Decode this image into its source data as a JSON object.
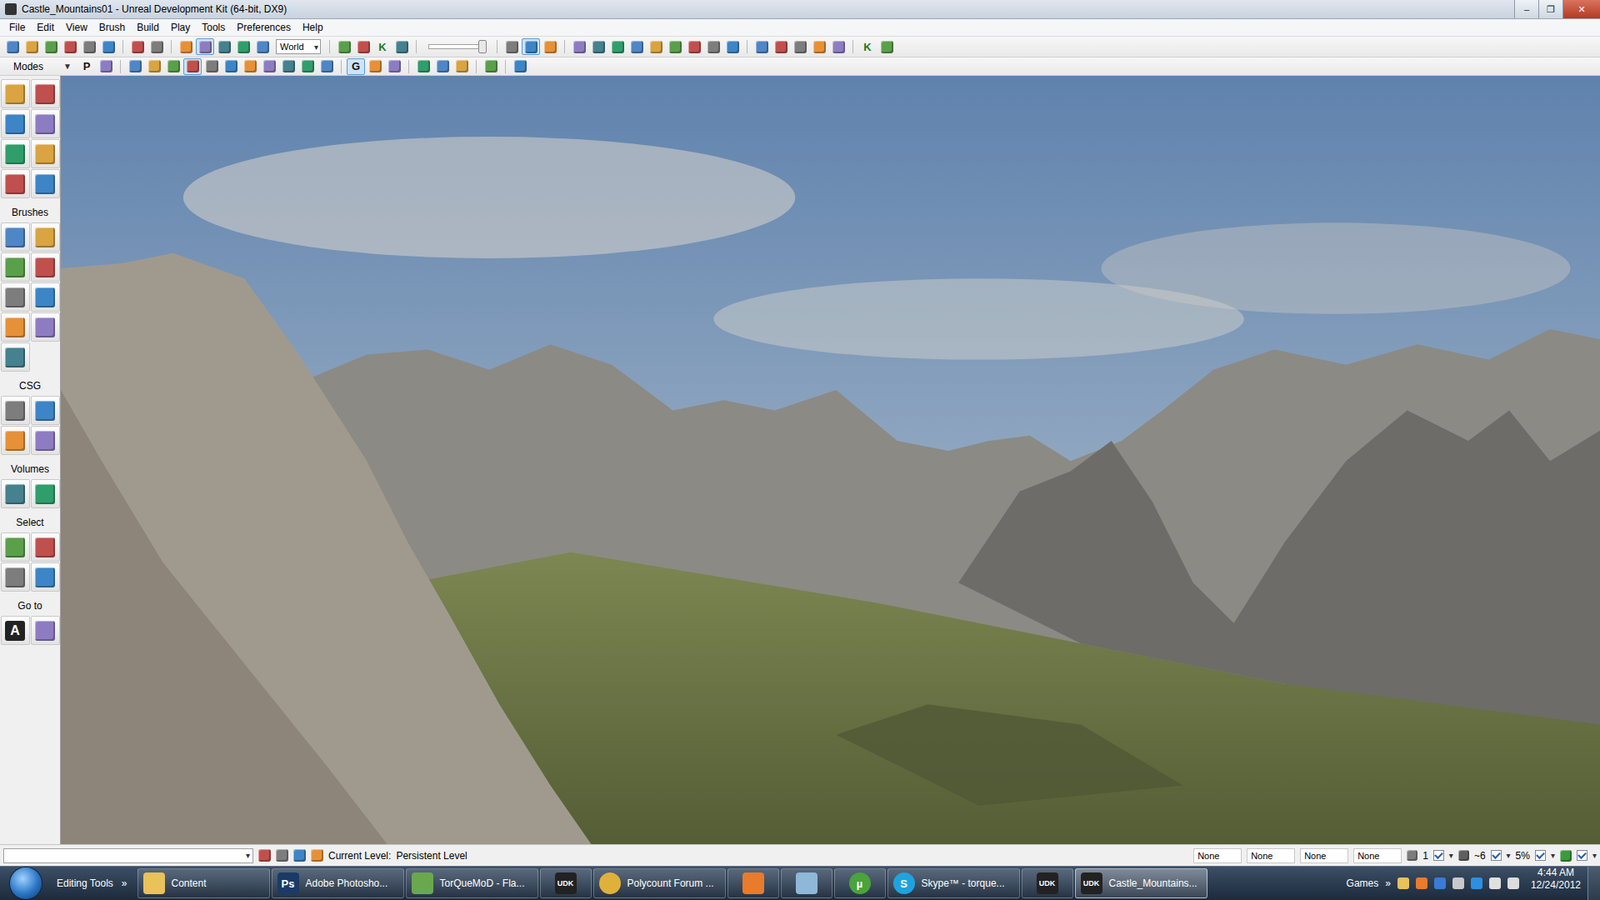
{
  "window": {
    "title": "Castle_Mountains01 - Unreal Development Kit (64-bit, DX9)",
    "controls": [
      "–",
      "❐",
      "✕"
    ]
  },
  "menu": [
    "File",
    "Edit",
    "View",
    "Brush",
    "Build",
    "Play",
    "Tools",
    "Preferences",
    "Help"
  ],
  "toolbar": [
    {
      "kind": "icons",
      "sep": false,
      "selected": [
        false,
        false,
        false,
        false,
        false,
        false
      ]
    },
    {
      "kind": "icons",
      "sep": true,
      "selected": [
        false,
        false
      ]
    },
    {
      "kind": "icons",
      "sep": true,
      "selected": [
        false,
        true,
        false,
        false,
        false
      ]
    },
    {
      "kind": "dropdown",
      "sep": false,
      "value": "World",
      "arrow": "▾"
    },
    {
      "kind": "icons",
      "sep": true,
      "selected": [
        false,
        false
      ]
    },
    {
      "kind": "letter",
      "sep": false,
      "text": "K",
      "selected": false
    },
    {
      "kind": "icons",
      "sep": false,
      "selected": [
        false
      ]
    },
    {
      "kind": "slider",
      "sep": true,
      "level": 0.95
    },
    {
      "kind": "icons",
      "sep": true,
      "selected": [
        false,
        true,
        false
      ]
    },
    {
      "kind": "icons",
      "sep": true,
      "selected": [
        false,
        false,
        false,
        false,
        false,
        false,
        false,
        false,
        false
      ]
    },
    {
      "kind": "icons",
      "sep": true,
      "selected": [
        false
      ]
    },
    {
      "kind": "icons",
      "sep": false,
      "selected": [
        false,
        false
      ]
    },
    {
      "kind": "icons",
      "sep": false,
      "selected": [
        false,
        false
      ]
    },
    {
      "kind": "letter",
      "sep": true,
      "text": "K",
      "selected": false
    },
    {
      "kind": "icons",
      "sep": false,
      "selected": [
        false
      ]
    }
  ],
  "mode_bar": {
    "label": "Modes",
    "menu_glyph": "▼",
    "items": [
      {
        "kind": "letter",
        "sep": false,
        "text": "P",
        "selected": false
      },
      {
        "kind": "icons",
        "sep": false,
        "selected": [
          false
        ]
      },
      {
        "kind": "icons",
        "sep": true,
        "selected": [
          false,
          false,
          false,
          true,
          false,
          false,
          false,
          false,
          false,
          false,
          false
        ]
      },
      {
        "kind": "letter",
        "sep": true,
        "text": "G",
        "selected": true
      },
      {
        "kind": "icons",
        "sep": false,
        "selected": [
          false,
          false
        ]
      },
      {
        "kind": "icons",
        "sep": true,
        "selected": [
          false,
          false,
          false
        ]
      },
      {
        "kind": "icons",
        "sep": true,
        "selected": [
          false
        ]
      },
      {
        "kind": "icons",
        "sep": true,
        "selected": [
          false
        ]
      }
    ]
  },
  "sidebar": {
    "mode_buttons": [
      {
        "selected": false
      },
      {
        "selected": false
      },
      {
        "selected": false
      },
      {
        "selected": false
      },
      {
        "selected": false
      },
      {
        "selected": false
      },
      {
        "selected": false
      },
      {
        "selected": false
      }
    ],
    "sections": [
      {
        "label": "Brushes",
        "buttons": [
          {
            "text": ""
          },
          {
            "text": ""
          },
          {
            "text": ""
          },
          {
            "text": ""
          },
          {
            "text": ""
          },
          {
            "text": ""
          },
          {
            "text": ""
          },
          {
            "text": ""
          },
          {
            "text": ""
          }
        ]
      },
      {
        "label": "CSG",
        "buttons": [
          {
            "text": ""
          },
          {
            "text": ""
          },
          {
            "text": ""
          },
          {
            "text": ""
          }
        ]
      },
      {
        "label": "Volumes",
        "buttons": [
          {
            "text": ""
          },
          {
            "text": ""
          }
        ]
      },
      {
        "label": "Select",
        "buttons": [
          {
            "text": ""
          },
          {
            "text": ""
          },
          {
            "text": ""
          },
          {
            "text": ""
          }
        ]
      },
      {
        "label": "Go to",
        "buttons": [
          {
            "text": "A"
          },
          {
            "text": ""
          }
        ]
      }
    ]
  },
  "status_bar": {
    "level_arrow": "▾",
    "current_level_label": "Current Level:",
    "current_level": "Persistent Level",
    "fields": [
      "None",
      "None",
      "None",
      "None"
    ],
    "grid_size": "1",
    "rotation": "~6",
    "scale": "5%",
    "arrow": "▾",
    "toggles": [
      {
        "checked": true
      },
      {
        "checked": true
      },
      {
        "checked": true
      },
      {
        "checked": true
      }
    ]
  },
  "taskbar": {
    "toolbar_label": "Editing Tools",
    "more": "»",
    "items": [
      {
        "kind": "folder",
        "label": "Content",
        "glyph": "",
        "selected": false
      },
      {
        "kind": "photoshop",
        "label": "Adobe Photosho...",
        "glyph": "Ps",
        "selected": false
      },
      {
        "kind": "flash",
        "label": "TorQueMoD - Fla...",
        "glyph": "",
        "selected": false
      },
      {
        "kind": "udk",
        "label": "",
        "glyph": "UDK",
        "selected": false
      },
      {
        "kind": "chrome",
        "label": "Polycount Forum ...",
        "glyph": "",
        "selected": false
      },
      {
        "kind": "mail",
        "label": "",
        "glyph": "",
        "selected": false
      },
      {
        "kind": "lync",
        "label": "",
        "glyph": "",
        "selected": false
      },
      {
        "kind": "torrent",
        "label": "",
        "glyph": "µ",
        "selected": false
      },
      {
        "kind": "skype",
        "label": "Skype™ - torque...",
        "glyph": "S",
        "selected": false
      },
      {
        "kind": "udk",
        "label": "",
        "glyph": "UDK",
        "selected": false
      },
      {
        "kind": "udk",
        "label": "Castle_Mountains...",
        "glyph": "UDK",
        "selected": true
      }
    ],
    "tray": {
      "label": "Games",
      "more": "»",
      "time": "4:44 AM",
      "date": "12/24/2012"
    }
  }
}
